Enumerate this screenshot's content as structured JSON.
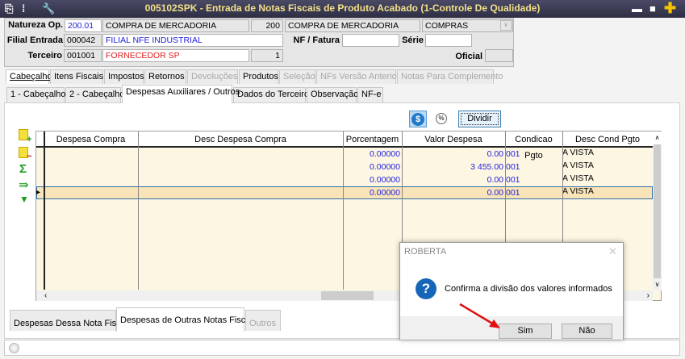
{
  "window": {
    "title": "005102SPK - Entrada de Notas Fiscais de Produto Acabado (1-Controle De Qualidade)"
  },
  "header": {
    "natureza_label": "Natureza Op.",
    "natureza_code": "200.01",
    "natureza_desc": "COMPRA DE MERCADORIA",
    "natureza_num": "200",
    "natureza_desc2": "COMPRA DE MERCADORIA",
    "tipo": "COMPRAS",
    "filial_label": "Filial Entrada",
    "filial_code": "000042",
    "filial_desc": "FILIAL NFE INDUSTRIAL",
    "nf_label": "NF / Fatura",
    "nf_value": "",
    "serie_label": "Série",
    "serie_value": "",
    "terceiro_label": "Terceiro",
    "terceiro_code": "001001",
    "terceiro_desc": "FORNECEDOR SP",
    "terceiro_num": "1",
    "oficial_label": "Oficial",
    "oficial_value": ""
  },
  "main_tabs": [
    {
      "label": "Cabeçalho",
      "active": true
    },
    {
      "label": "Itens Fiscais"
    },
    {
      "label": "Impostos"
    },
    {
      "label": "Retornos"
    },
    {
      "label": "Devoluções",
      "disabled": true
    },
    {
      "label": "Produtos"
    },
    {
      "label": "Seleção",
      "disabled": true
    },
    {
      "label": "NFs Versão Anterior",
      "disabled": true
    },
    {
      "label": "Notas Para Complemento",
      "disabled": true
    }
  ],
  "sub_tabs": [
    {
      "label": "1 - Cabeçalho"
    },
    {
      "label": "2 - Cabeçalho"
    },
    {
      "label": "Despesas Auxiliares / Outros",
      "active": true
    },
    {
      "label": "Dados do Terceiro"
    },
    {
      "label": "Observação"
    },
    {
      "label": "NF-e"
    }
  ],
  "toolbar": {
    "dollar_icon": "$",
    "percent_icon": "%",
    "divide_label": "Dividir"
  },
  "grid": {
    "columns": [
      "Despesa Compra",
      "Desc Despesa Compra",
      "Porcentagem",
      "Valor Despesa",
      "Condicao Pgto",
      "Desc Cond Pgto"
    ],
    "rows": [
      [
        "",
        "",
        "0.00000",
        "0.00",
        "001",
        "A VISTA"
      ],
      [
        "",
        "",
        "0.00000",
        "3 455.00",
        "001",
        "A VISTA"
      ],
      [
        "",
        "",
        "0.00000",
        "0.00",
        "001",
        "A VISTA"
      ],
      [
        "",
        "",
        "0.00000",
        "0.00",
        "001",
        "A VISTA"
      ]
    ]
  },
  "bottom_tabs": [
    {
      "label": "Despesas Dessa Nota Fiscal"
    },
    {
      "label": "Despesas de Outras Notas Fiscais",
      "active": true
    },
    {
      "label": "Outros",
      "disabled": true
    }
  ],
  "dialog": {
    "title": "ROBERTA",
    "message": "Confirma a divisão dos valores informados",
    "yes": "Sim",
    "no": "Não"
  },
  "colors": {
    "titlebar": "#3a3a55",
    "grid_bg": "#fdf6e3",
    "selected_row": "#f9e3b8",
    "accent_blue": "#2222dd",
    "arrow": "#e01010"
  }
}
